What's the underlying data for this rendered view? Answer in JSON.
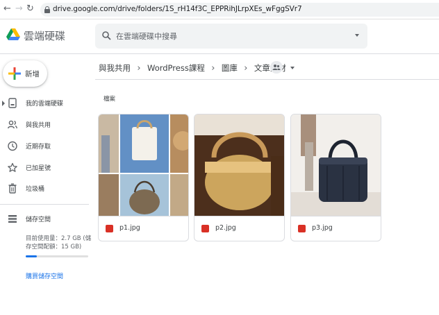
{
  "browser": {
    "url": "drive.google.com/drive/folders/1S_rH14f3C_EPPRihJLrpXEs_wFggSVr7"
  },
  "app": {
    "title": "雲端硬碟",
    "search_placeholder": "在雲端硬碟中搜尋"
  },
  "sidebar": {
    "new_label": "新增",
    "items": [
      {
        "label": "我的雲端硬碟",
        "icon": "my-drive-icon"
      },
      {
        "label": "與我共用",
        "icon": "shared-people-icon"
      },
      {
        "label": "近期存取",
        "icon": "clock-icon"
      },
      {
        "label": "已加星號",
        "icon": "star-icon"
      },
      {
        "label": "垃圾桶",
        "icon": "trash-icon"
      }
    ],
    "storage": {
      "label": "儲存空間",
      "usage_text": "目前使用量：2.7 GB (儲存空間配額：15 GB)",
      "used_fraction": 0.18,
      "buy_label": "購買儲存空間"
    }
  },
  "breadcrumb": [
    "與我共用",
    "WordPress課程",
    "圖庫",
    "文章素材"
  ],
  "section_label": "檔案",
  "files": [
    {
      "name": "p1.jpg"
    },
    {
      "name": "p2.jpg"
    },
    {
      "name": "p3.jpg"
    }
  ],
  "colors": {
    "accent": "#1a73e8",
    "image_icon": "#d93025"
  }
}
